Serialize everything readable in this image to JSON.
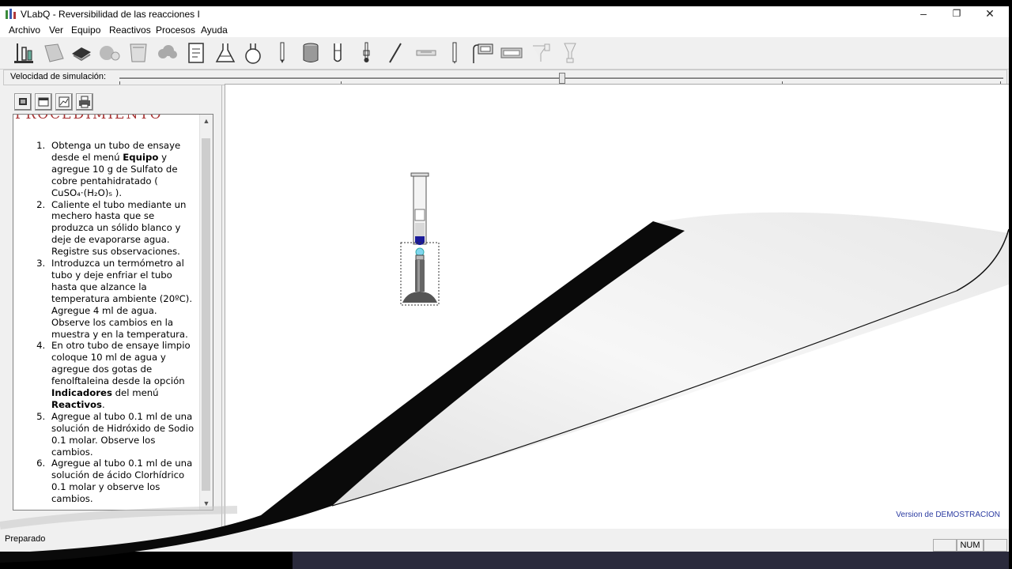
{
  "window": {
    "title": "VLabQ - Reversibilidad de las reacciones I",
    "controls": {
      "minimize": "–",
      "maximize": "❐",
      "close": "✕"
    }
  },
  "menu": [
    "Archivo",
    "Ver",
    "Equipo",
    "Reactivos",
    "Procesos",
    "Ayuda"
  ],
  "toolbar": {
    "tools": [
      "lab-stand-icon",
      "paper-icon",
      "book-icon",
      "balance-icon",
      "beaker-icon",
      "cloud-icon",
      "document-icon",
      "erlenmeyer-flask-icon",
      "round-flask-icon",
      "pipette-icon",
      "cylinder-icon",
      "test-tube-icon",
      "thermometer-icon",
      "stirring-rod-icon",
      "ruler-icon",
      "burette-icon",
      "ph-meter-icon",
      "digital-display-icon",
      "funnel-icon",
      "separatory-funnel-icon"
    ]
  },
  "speed": {
    "label": "Velocidad de simulación:",
    "value": 0.5
  },
  "procedure": {
    "heading": "PROCEDIMIENTO",
    "steps": [
      [
        {
          "t": "Obtenga un tubo de ensaye desde el menú "
        },
        {
          "t": "Equipo",
          "b": true
        },
        {
          "t": " y agregue 10 g de Sulfato de cobre pentahidratado ( CuSO₄·(H₂O)₅ )."
        }
      ],
      [
        {
          "t": "Caliente el tubo mediante un mechero hasta que se produzca un sólido blanco y deje de evaporarse agua. Registre sus observaciones."
        }
      ],
      [
        {
          "t": "Introduzca un termómetro al tubo y deje enfriar el tubo hasta que alzance la temperatura ambiente (20ºC). Agregue 4 ml de agua. Observe los cambios en la muestra y en la temperatura."
        }
      ],
      [
        {
          "t": "En otro tubo de ensaye limpio coloque 10 ml de agua y agregue dos gotas de fenolftaleina desde la opción "
        },
        {
          "t": "Indicadores",
          "b": true
        },
        {
          "t": " del menú "
        },
        {
          "t": "Reactivos",
          "b": true
        },
        {
          "t": "."
        }
      ],
      [
        {
          "t": "Agregue al tubo 0.1 ml de una solución de Hidróxido de Sodio 0.1 molar. Observe los cambios."
        }
      ],
      [
        {
          "t": "Agregue al tubo 0.1 ml de una solución de ácido Clorhídrico 0.1 molar y observe los cambios."
        }
      ]
    ]
  },
  "canvas": {
    "demo_label": "Version de DEMOSTRACION"
  },
  "status": {
    "text": "Preparado",
    "num": "NUM"
  }
}
